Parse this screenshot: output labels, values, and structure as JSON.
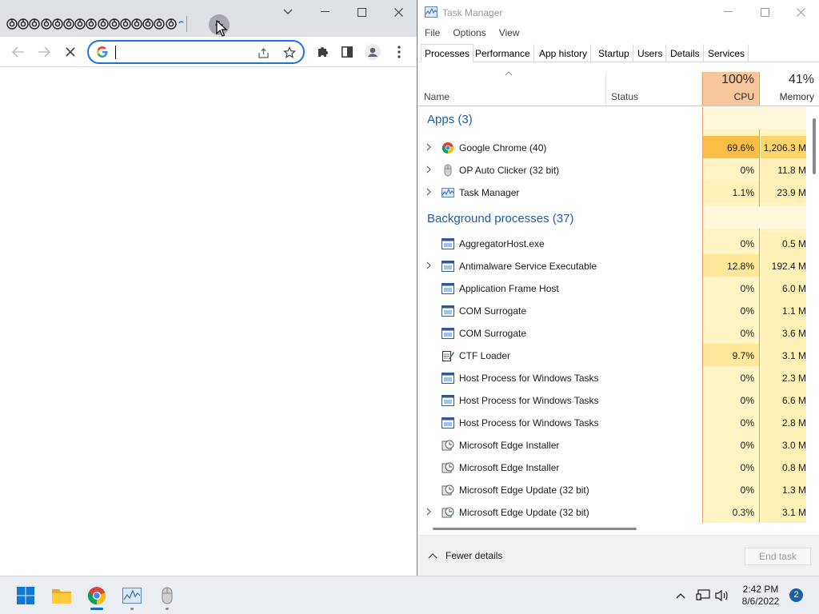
{
  "chrome": {
    "tab_count_icons": 15,
    "omnibox": {
      "value": "",
      "placeholder": ""
    }
  },
  "taskmgr": {
    "title": "Task Manager",
    "menu": [
      "File",
      "Options",
      "View"
    ],
    "tabs": [
      "Processes",
      "Performance",
      "App history",
      "Startup",
      "Users",
      "Details",
      "Services"
    ],
    "active_tab": "Processes",
    "header": {
      "name": "Name",
      "status": "Status",
      "cpu_pct": "100%",
      "cpu_label": "CPU",
      "mem_pct": "41%",
      "mem_label": "Memory"
    },
    "groups": {
      "apps": "Apps (3)",
      "background": "Background processes (37)"
    },
    "apps": [
      {
        "name": "Google Chrome (40)",
        "cpu": "69.6%",
        "mem": "1,206.3 M",
        "icon": "chrome-icon",
        "expandable": true,
        "heat": "#fbbf45"
      },
      {
        "name": "OP Auto Clicker (32 bit)",
        "cpu": "0%",
        "mem": "11.8 M",
        "icon": "mouse-icon",
        "expandable": true,
        "heat": "#fff4c4"
      },
      {
        "name": "Task Manager",
        "cpu": "1.1%",
        "mem": "23.9 M",
        "icon": "taskmgr-icon",
        "expandable": true,
        "heat": "#fff0b8"
      }
    ],
    "background": [
      {
        "name": "AggregatorHost.exe",
        "cpu": "0%",
        "mem": "0.5 M",
        "icon": "window-app-icon",
        "expandable": false,
        "heat": "#fff4c4"
      },
      {
        "name": "Antimalware Service Executable",
        "cpu": "12.8%",
        "mem": "192.4 M",
        "icon": "window-app-icon",
        "expandable": true,
        "heat": "#ffe79a"
      },
      {
        "name": "Application Frame Host",
        "cpu": "0%",
        "mem": "6.0 M",
        "icon": "window-app-icon",
        "expandable": false,
        "heat": "#fff4c4"
      },
      {
        "name": "COM Surrogate",
        "cpu": "0%",
        "mem": "1.1 M",
        "icon": "window-app-icon",
        "expandable": false,
        "heat": "#fff4c4"
      },
      {
        "name": "COM Surrogate",
        "cpu": "0%",
        "mem": "3.6 M",
        "icon": "window-app-icon",
        "expandable": false,
        "heat": "#fff4c4"
      },
      {
        "name": "CTF Loader",
        "cpu": "9.7%",
        "mem": "3.1 M",
        "icon": "notepad-icon",
        "expandable": false,
        "heat": "#ffe79a"
      },
      {
        "name": "Host Process for Windows Tasks",
        "cpu": "0%",
        "mem": "2.3 M",
        "icon": "window-app-icon",
        "expandable": false,
        "heat": "#fff4c4"
      },
      {
        "name": "Host Process for Windows Tasks",
        "cpu": "0%",
        "mem": "6.6 M",
        "icon": "window-app-icon",
        "expandable": false,
        "heat": "#fff4c4"
      },
      {
        "name": "Host Process for Windows Tasks",
        "cpu": "0%",
        "mem": "2.8 M",
        "icon": "window-app-icon",
        "expandable": false,
        "heat": "#fff4c4"
      },
      {
        "name": "Microsoft Edge Installer",
        "cpu": "0%",
        "mem": "3.0 M",
        "icon": "installer-icon",
        "expandable": false,
        "heat": "#fff4c4"
      },
      {
        "name": "Microsoft Edge Installer",
        "cpu": "0%",
        "mem": "0.8 M",
        "icon": "installer-icon",
        "expandable": false,
        "heat": "#fff4c4"
      },
      {
        "name": "Microsoft Edge Update (32 bit)",
        "cpu": "0%",
        "mem": "1.3 M",
        "icon": "installer-icon",
        "expandable": false,
        "heat": "#fff4c4"
      },
      {
        "name": "Microsoft Edge Update (32 bit)",
        "cpu": "0.3%",
        "mem": "3.1 M",
        "icon": "installer-icon",
        "expandable": true,
        "heat": "#fff4c4"
      }
    ],
    "footer": {
      "fewer_details": "Fewer details",
      "end_task": "End task"
    }
  },
  "taskbar": {
    "apps": [
      "start-icon",
      "file-explorer-icon",
      "chrome-icon",
      "task-manager-icon",
      "auto-clicker-icon"
    ],
    "clock": {
      "time": "2:42 PM",
      "date": "8/6/2022"
    },
    "notifications": "2"
  },
  "colors": {
    "accent": "#1a73e8",
    "group_heading": "#1e5ea8",
    "cpu_header": "#f7c69b",
    "heat_low": "#fff4c4",
    "heat_high": "#fbbf45"
  }
}
